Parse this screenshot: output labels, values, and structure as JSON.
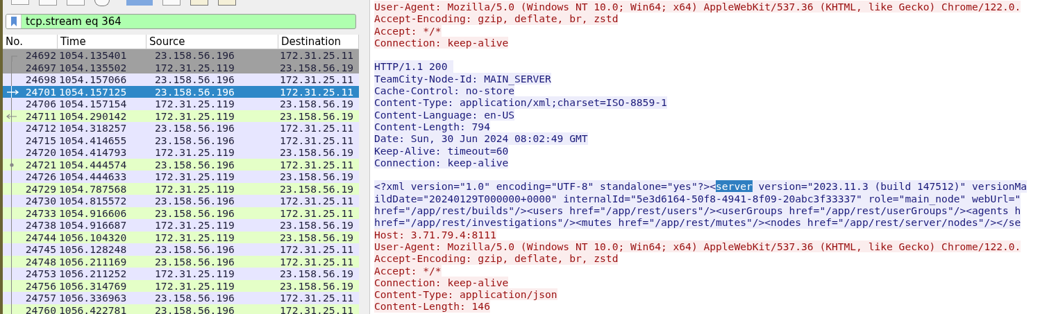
{
  "filter": {
    "value": "tcp.stream eq 364"
  },
  "packet_list": {
    "columns": [
      "No.",
      "Time",
      "Source",
      "Destination"
    ],
    "rows": [
      {
        "no": "24692",
        "time": "1054.135401",
        "source": "23.158.56.196",
        "destination": "172.31.25.11",
        "color": "#a0a0a0",
        "kind": "start",
        "selected": false
      },
      {
        "no": "24697",
        "time": "1054.135502",
        "source": "172.31.25.119",
        "destination": "23.158.56.19",
        "color": "#a0a0a0",
        "kind": "plain",
        "selected": false
      },
      {
        "no": "24698",
        "time": "1054.157066",
        "source": "23.158.56.196",
        "destination": "172.31.25.11",
        "color": "#e7e6ff",
        "kind": "plain",
        "selected": false
      },
      {
        "no": "24701",
        "time": "1054.157125",
        "source": "23.158.56.196",
        "destination": "172.31.25.11",
        "kind": "request",
        "selected": true
      },
      {
        "no": "24706",
        "time": "1054.157154",
        "source": "172.31.25.119",
        "destination": "23.158.56.19",
        "color": "#e7e6ff",
        "kind": "plain",
        "selected": false
      },
      {
        "no": "24711",
        "time": "1054.290142",
        "source": "172.31.25.119",
        "destination": "23.158.56.19",
        "color": "#e4ffc7",
        "kind": "response",
        "selected": false
      },
      {
        "no": "24712",
        "time": "1054.318257",
        "source": "23.158.56.196",
        "destination": "172.31.25.11",
        "color": "#e7e6ff",
        "kind": "plain",
        "selected": false
      },
      {
        "no": "24715",
        "time": "1054.414655",
        "source": "23.158.56.196",
        "destination": "172.31.25.11",
        "color": "#e7e6ff",
        "kind": "plain",
        "selected": false
      },
      {
        "no": "24720",
        "time": "1054.414793",
        "source": "172.31.25.119",
        "destination": "23.158.56.19",
        "color": "#e7e6ff",
        "kind": "plain",
        "selected": false
      },
      {
        "no": "24721",
        "time": "1054.444574",
        "source": "23.158.56.196",
        "destination": "172.31.25.11",
        "color": "#e4ffc7",
        "kind": "ack",
        "selected": false
      },
      {
        "no": "24726",
        "time": "1054.444633",
        "source": "172.31.25.119",
        "destination": "23.158.56.19",
        "color": "#e7e6ff",
        "kind": "plain",
        "selected": false
      },
      {
        "no": "24729",
        "time": "1054.787568",
        "source": "172.31.25.119",
        "destination": "23.158.56.19",
        "color": "#e4ffc7",
        "kind": "plain",
        "selected": false
      },
      {
        "no": "24730",
        "time": "1054.815572",
        "source": "23.158.56.196",
        "destination": "172.31.25.11",
        "color": "#e7e6ff",
        "kind": "plain",
        "selected": false
      },
      {
        "no": "24733",
        "time": "1054.916606",
        "source": "23.158.56.196",
        "destination": "172.31.25.11",
        "color": "#e4ffc7",
        "kind": "plain",
        "selected": false
      },
      {
        "no": "24738",
        "time": "1054.916687",
        "source": "172.31.25.119",
        "destination": "23.158.56.19",
        "color": "#e7e6ff",
        "kind": "plain",
        "selected": false
      },
      {
        "no": "24744",
        "time": "1056.104320",
        "source": "172.31.25.119",
        "destination": "23.158.56.19",
        "color": "#e4ffc7",
        "kind": "plain",
        "selected": false
      },
      {
        "no": "24745",
        "time": "1056.128248",
        "source": "23.158.56.196",
        "destination": "172.31.25.11",
        "color": "#e7e6ff",
        "kind": "plain",
        "selected": false
      },
      {
        "no": "24748",
        "time": "1056.211169",
        "source": "23.158.56.196",
        "destination": "172.31.25.11",
        "color": "#e4ffc7",
        "kind": "plain",
        "selected": false
      },
      {
        "no": "24753",
        "time": "1056.211252",
        "source": "172.31.25.119",
        "destination": "23.158.56.19",
        "color": "#e7e6ff",
        "kind": "plain",
        "selected": false
      },
      {
        "no": "24756",
        "time": "1056.314769",
        "source": "172.31.25.119",
        "destination": "23.158.56.19",
        "color": "#e4ffc7",
        "kind": "plain",
        "selected": false
      },
      {
        "no": "24757",
        "time": "1056.336963",
        "source": "23.158.56.196",
        "destination": "172.31.25.11",
        "color": "#e7e6ff",
        "kind": "plain",
        "selected": false
      },
      {
        "no": "24760",
        "time": "1056.422781",
        "source": "23.158.56.196",
        "destination": "172.31.25.11",
        "color": "#e4ffc7",
        "kind": "plain",
        "selected": false
      }
    ]
  },
  "stream": {
    "lines": [
      {
        "kind": "request",
        "segments": [
          {
            "text": "User-Agent: Mozilla/5.0 (Windows NT 10.0; Win64; x64) AppleWebKit/537.36 (KHTML, like Gecko) Chrome/122.0.",
            "highlight": false
          }
        ]
      },
      {
        "kind": "request",
        "segments": [
          {
            "text": "Accept-Encoding: gzip, deflate, br, zstd",
            "highlight": false
          }
        ]
      },
      {
        "kind": "request",
        "segments": [
          {
            "text": "Accept: */*",
            "highlight": false
          }
        ]
      },
      {
        "kind": "request",
        "segments": [
          {
            "text": "Connection: keep-alive",
            "highlight": false
          }
        ]
      },
      {
        "kind": "blank"
      },
      {
        "kind": "response",
        "segments": [
          {
            "text": "HTTP/1.1 200 ",
            "highlight": false
          }
        ]
      },
      {
        "kind": "response",
        "segments": [
          {
            "text": "TeamCity-Node-Id: MAIN_SERVER",
            "highlight": false
          }
        ]
      },
      {
        "kind": "response",
        "segments": [
          {
            "text": "Cache-Control: no-store",
            "highlight": false
          }
        ]
      },
      {
        "kind": "response",
        "segments": [
          {
            "text": "Content-Type: application/xml;charset=ISO-8859-1",
            "highlight": false
          }
        ]
      },
      {
        "kind": "response",
        "segments": [
          {
            "text": "Content-Language: en-US",
            "highlight": false
          }
        ]
      },
      {
        "kind": "response",
        "segments": [
          {
            "text": "Content-Length: 794",
            "highlight": false
          }
        ]
      },
      {
        "kind": "response",
        "segments": [
          {
            "text": "Date: Sun, 30 Jun 2024 08:02:49 GMT",
            "highlight": false
          }
        ]
      },
      {
        "kind": "response",
        "segments": [
          {
            "text": "Keep-Alive: timeout=60",
            "highlight": false
          }
        ]
      },
      {
        "kind": "response",
        "segments": [
          {
            "text": "Connection: keep-alive",
            "highlight": false
          }
        ]
      },
      {
        "kind": "blank"
      },
      {
        "kind": "response",
        "segments": [
          {
            "text": "<?xml version=\"1.0\" encoding=\"UTF-8\" standalone=\"yes\"?><",
            "highlight": false
          },
          {
            "text": "server",
            "highlight": true
          },
          {
            "text": " version=\"2023.11.3 (build 147512)\" versionMa",
            "highlight": false
          }
        ]
      },
      {
        "kind": "response",
        "segments": [
          {
            "text": "ildDate=\"20240129T000000+0000\" internalId=\"5e3d6164-50f8-4941-8f09-20abc3f33337\" role=\"main_node\" webUrl=\"",
            "highlight": false
          }
        ]
      },
      {
        "kind": "response",
        "segments": [
          {
            "text": "href=\"/app/rest/builds\"/><users href=\"/app/rest/users\"/><userGroups href=\"/app/rest/userGroups\"/><agents h",
            "highlight": false
          }
        ]
      },
      {
        "kind": "response",
        "segments": [
          {
            "text": "href=\"/app/rest/investigations\"/><mutes href=\"/app/rest/mutes\"/><nodes href=\"/app/rest/server/nodes\"/></se",
            "highlight": false
          }
        ]
      },
      {
        "kind": "request",
        "segments": [
          {
            "text": "Host: 3.71.79.4:8111",
            "highlight": false
          }
        ]
      },
      {
        "kind": "request",
        "segments": [
          {
            "text": "User-Agent: Mozilla/5.0 (Windows NT 10.0; Win64; x64) AppleWebKit/537.36 (KHTML, like Gecko) Chrome/122.0.",
            "highlight": false
          }
        ]
      },
      {
        "kind": "request",
        "segments": [
          {
            "text": "Accept-Encoding: gzip, deflate, br, zstd",
            "highlight": false
          }
        ]
      },
      {
        "kind": "request",
        "segments": [
          {
            "text": "Accept: */*",
            "highlight": false
          }
        ]
      },
      {
        "kind": "request",
        "segments": [
          {
            "text": "Connection: keep-alive",
            "highlight": false
          }
        ]
      },
      {
        "kind": "request",
        "segments": [
          {
            "text": "Content-Type: application/json",
            "highlight": false
          }
        ]
      },
      {
        "kind": "request",
        "segments": [
          {
            "text": "Content-Length: 146",
            "highlight": false
          }
        ]
      }
    ]
  }
}
